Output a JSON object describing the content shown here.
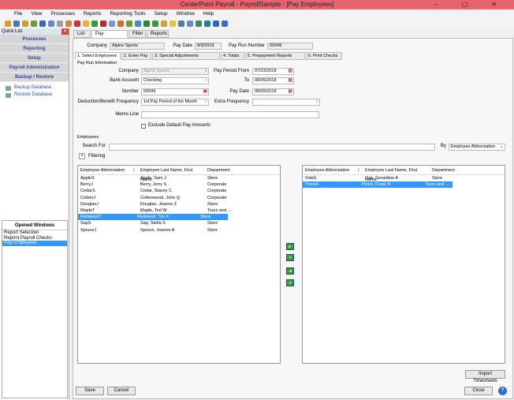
{
  "window": {
    "title": "CenterPoint Payroll - PayrollSample - [Pay Employees]"
  },
  "menu": [
    "File",
    "View",
    "Processes",
    "Reports",
    "Reporting Tools",
    "Setup",
    "Window",
    "Help"
  ],
  "quicklist": {
    "title": "Quick List",
    "sections": [
      "Processes",
      "Reporting",
      "Setup",
      "Payroll Administration",
      "Backup / Restore"
    ],
    "links": [
      "Backup Database",
      "Restore Database"
    ]
  },
  "opened_windows": {
    "title": "Opened Windows",
    "items": [
      "Report Selection",
      "Reprint Payroll Checks",
      "Pay Employees"
    ]
  },
  "top_tabs": [
    "List",
    "Pay Employees",
    "Filter",
    "Reports"
  ],
  "header": {
    "company_label": "Company",
    "company": "Alpine Sports",
    "pay_date_label": "Pay Date",
    "pay_date": "8/9/2018",
    "run_label": "Pay Run Number",
    "run": "00049"
  },
  "steps": [
    "1. Select Employees",
    "2. Enter Pay",
    "3. Special Adjustments",
    "4. Totals",
    "5. Prepayment Reports",
    "6. Print Checks"
  ],
  "payrun": {
    "title": "Pay Run Information",
    "company_label": "Company",
    "company": "Alpine Sports",
    "bank_label": "Bank Account",
    "bank": "Checking",
    "number_label": "Number",
    "number": "00049",
    "freq_label": "Deduction/Benefit Frequency",
    "freq": "1st Pay Period of the Month",
    "memo_label": "Memo Line",
    "memo": "",
    "from_label": "Pay Period From",
    "from": "07/23/2018",
    "to_label": "To",
    "to": "08/05/2018",
    "paydate_label": "Pay Date",
    "paydate": "08/09/2018",
    "extra_label": "Extra Frequency",
    "extra": "",
    "exclude_label": "Exclude Default Pay Amounts"
  },
  "employees": {
    "title": "Employees",
    "search_label": "Search For",
    "search": "",
    "by_label": "By",
    "by": "Employee Abbreviation",
    "filtering": "Filtering",
    "columns": [
      "Employee Abbreviation",
      "/",
      "Employee Last Name, First Name",
      "Department"
    ],
    "left": [
      [
        "AppleS",
        "Apple, Sam J",
        "Store"
      ],
      [
        "BerryJ",
        "Berry, Jerry S",
        "Corporate"
      ],
      [
        "CedarS",
        "Cedar, Stacey C",
        "Corporate"
      ],
      [
        "CottonJ",
        "Cottonwood, John Q",
        "Corporate"
      ],
      [
        "DouglasJ",
        "Douglas, Jeanne Z",
        "Store"
      ],
      [
        "MapleT",
        "Maple, Ted W",
        "Tours and ..."
      ],
      [
        "RedwoodT",
        "Redwood, Tim X",
        "Store"
      ],
      [
        "SapS",
        "Sap, Stella S",
        "Store"
      ],
      [
        "SpruceJ",
        "Spruce, Joanne A",
        "Store"
      ]
    ],
    "left_selected": 6,
    "right": [
      [
        "OakG",
        "Oak, Geraldine A",
        "Store"
      ],
      [
        "PinonF",
        "Pinon, Frank R",
        "Tours and ..."
      ]
    ],
    "right_selected": 1
  },
  "buttons": {
    "import": "Import Timesheets",
    "save": "Save",
    "cancel": "Cancel",
    "close": "Close",
    "help": "?"
  }
}
